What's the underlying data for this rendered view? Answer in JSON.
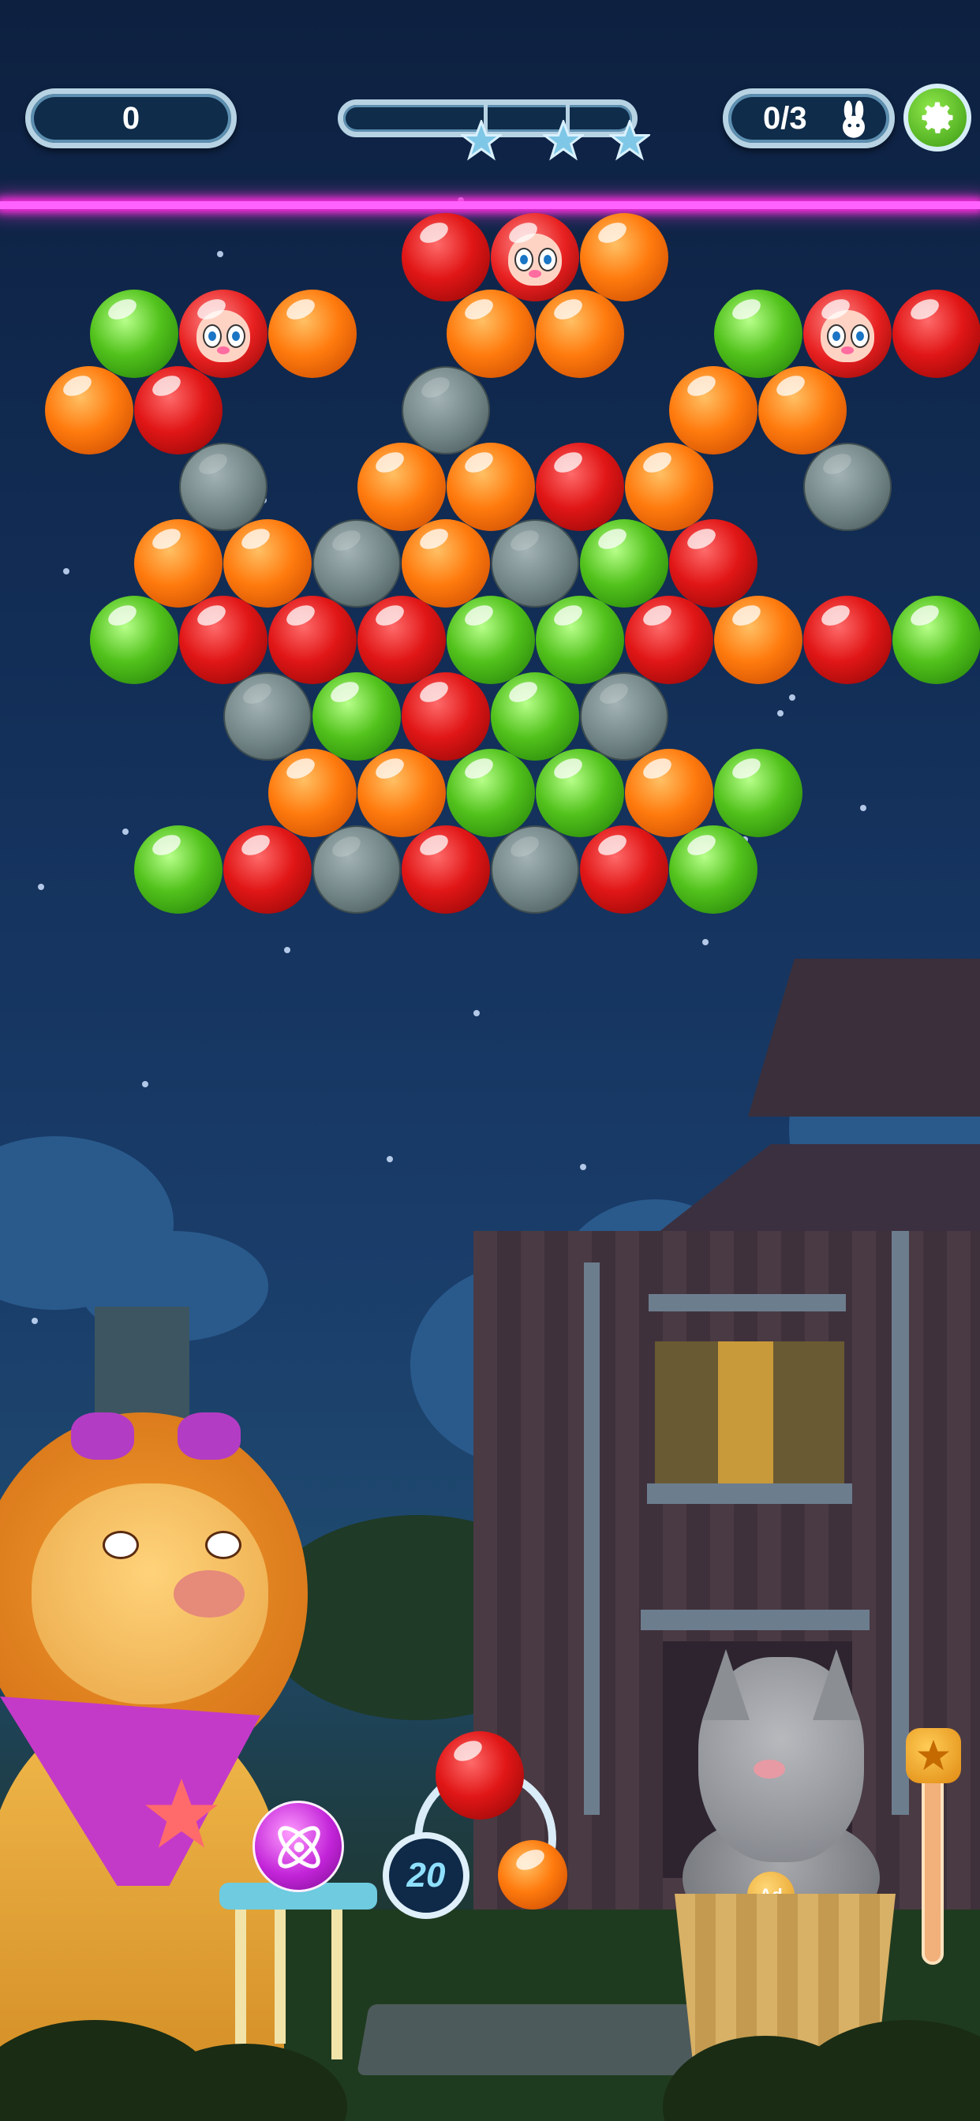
{
  "hud": {
    "score": "0",
    "goal": "0/3",
    "goal_icon": "bunny-icon",
    "star_progress": 0,
    "stars_total": 3,
    "settings_icon": "gear-icon"
  },
  "shooter": {
    "moves_left": "20",
    "loaded_bubble": "red",
    "next_bubble": "orange",
    "booster_icon": "magic-orb-icon"
  },
  "characters": {
    "lion_medal_text": "",
    "dog_medal_text": "Ad"
  },
  "colors": {
    "laser": "#ff62ff",
    "progress_fill": "#6ee0ff",
    "red": "#e11616",
    "orange": "#ff7b0e",
    "green": "#52c21c",
    "stone": "#6f8284"
  },
  "board": {
    "rows": [
      [
        "",
        "",
        "",
        "",
        "R",
        "Cr",
        "O",
        "",
        "",
        "",
        ""
      ],
      [
        "G",
        "Cr",
        "O",
        "",
        "O",
        "O",
        "",
        "G",
        "Cr",
        "R",
        ""
      ],
      [
        "O",
        "R",
        "",
        "",
        "S",
        "",
        "",
        "O",
        "O",
        ""
      ],
      [
        "",
        "S",
        "",
        "O",
        "O",
        "R",
        "O",
        "",
        "S",
        "",
        ""
      ],
      [
        "",
        "O",
        "O",
        "S",
        "O",
        "S",
        "G",
        "R",
        "",
        ""
      ],
      [
        "G",
        "R",
        "R",
        "R",
        "G",
        "G",
        "R",
        "O",
        "R",
        "G",
        ""
      ],
      [
        "",
        "",
        "S",
        "G",
        "R",
        "G",
        "S",
        "",
        "",
        ""
      ],
      [
        "",
        "",
        "O",
        "O",
        "G",
        "G",
        "O",
        "G",
        "",
        "",
        ""
      ],
      [
        "",
        "G",
        "R",
        "S",
        "R",
        "S",
        "R",
        "G",
        "",
        ""
      ]
    ]
  }
}
